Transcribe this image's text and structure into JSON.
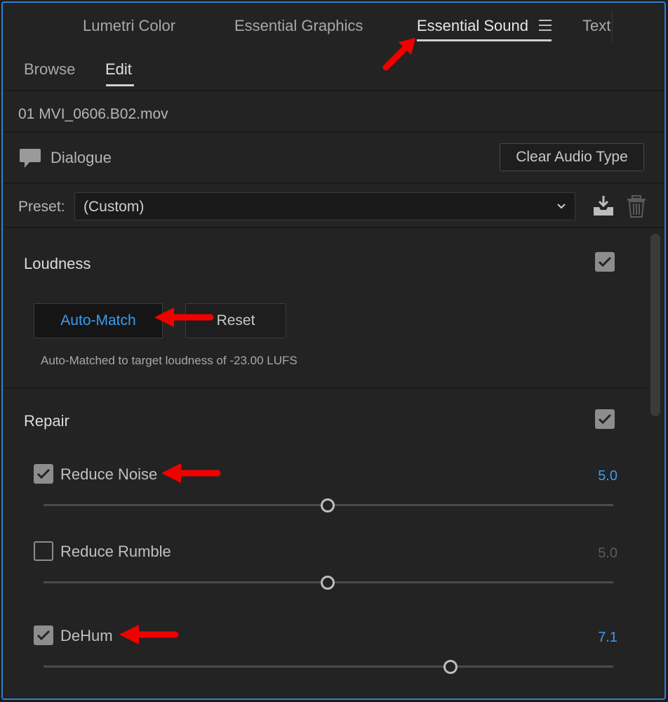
{
  "tabs": {
    "items": [
      {
        "label": "Lumetri Color"
      },
      {
        "label": "Essential Graphics"
      },
      {
        "label": "Essential Sound"
      },
      {
        "label": "Text"
      }
    ],
    "active": "Essential Sound"
  },
  "subtabs": [
    {
      "label": "Browse"
    },
    {
      "label": "Edit"
    }
  ],
  "clip": {
    "file_name": "01 MVI_0606.B02.mov"
  },
  "audio_type": {
    "label": "Dialogue",
    "icon": "speech-bubble-icon",
    "clear_button": "Clear Audio Type"
  },
  "preset": {
    "label": "Preset:",
    "value": "(Custom)"
  },
  "loudness": {
    "title": "Loudness",
    "enabled": true,
    "auto_match_button": "Auto-Match",
    "reset_button": "Reset",
    "status": "Auto-Matched to target loudness of -23.00 LUFS"
  },
  "repair": {
    "title": "Repair",
    "enabled": true,
    "items": [
      {
        "label": "Reduce Noise",
        "checked": true,
        "value": "5.0",
        "level": 0.5
      },
      {
        "label": "Reduce Rumble",
        "checked": false,
        "value": "5.0",
        "level": 0.5
      },
      {
        "label": "DeHum",
        "checked": true,
        "value": "7.1",
        "level": 0.71
      }
    ]
  },
  "colors": {
    "accent": "#3a9cf0",
    "annotation_arrow": "#f20000",
    "panel_focus_border": "#2d7fd3"
  }
}
